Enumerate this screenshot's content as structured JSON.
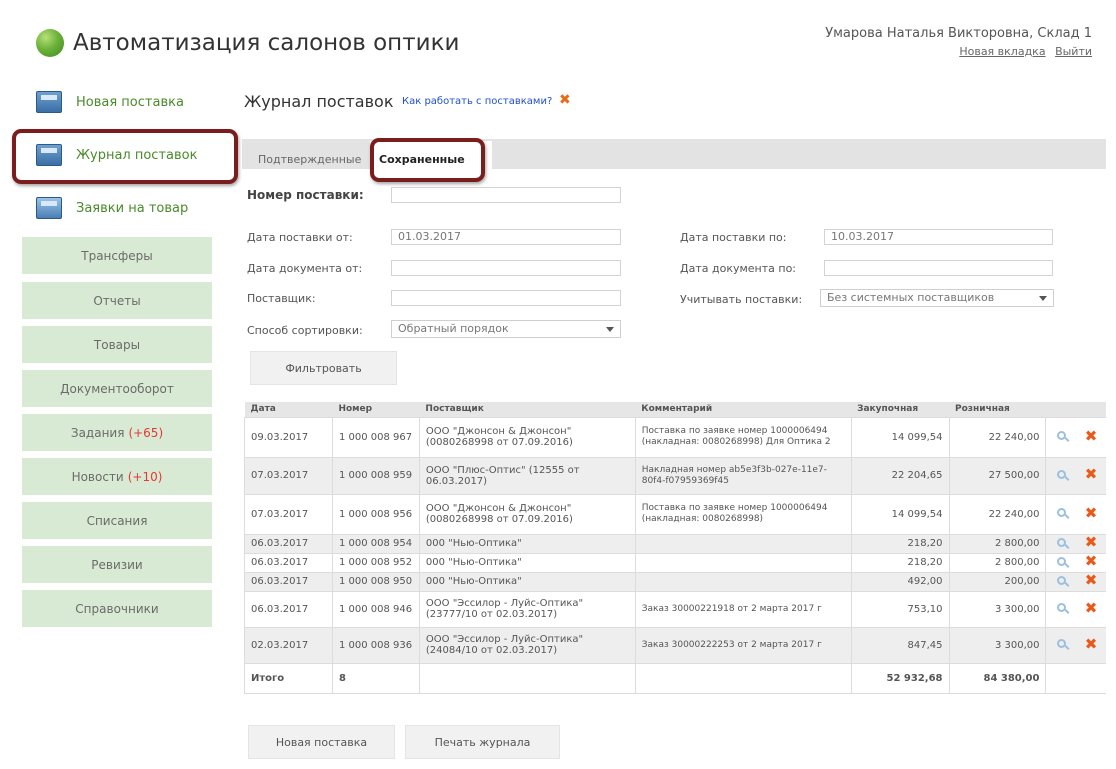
{
  "header": {
    "app_title": "Автоматизация салонов оптики",
    "user_name": "Умарова Наталья Викторовна, Склад 1",
    "new_tab_link": "Новая вкладка",
    "logout_link": "Выйти"
  },
  "sidebar": {
    "icon_items": [
      {
        "label": "Новая поставка",
        "icon": "delivery-box-icon"
      },
      {
        "label": "Журнал поставок",
        "icon": "journal-box-icon"
      },
      {
        "label": "Заявки на товар",
        "icon": "requests-icon"
      }
    ],
    "menu": [
      {
        "label": "Трансферы"
      },
      {
        "label": "Отчеты"
      },
      {
        "label": "Товары"
      },
      {
        "label": "Документооборот"
      },
      {
        "label": "Задания",
        "badge": "(+65)"
      },
      {
        "label": "Новости",
        "badge": "(+10)"
      },
      {
        "label": "Списания"
      },
      {
        "label": "Ревизии"
      },
      {
        "label": "Справочники"
      }
    ]
  },
  "main": {
    "title": "Журнал поставок",
    "help_link": "Как работать с поставками?",
    "tabs": [
      "Подтвержденные",
      "Сохраненные"
    ],
    "form": {
      "number_label": "Номер поставки:",
      "number_value": "",
      "date_from_label": "Дата поставки от:",
      "date_from_value": "01.03.2017",
      "date_to_label": "Дата поставки по:",
      "date_to_value": "10.03.2017",
      "doc_from_label": "Дата документа от:",
      "doc_from_value": "",
      "doc_to_label": "Дата документа по:",
      "doc_to_value": "",
      "supplier_label": "Поставщик:",
      "supplier_value": "",
      "count_label": "Учитывать поставки:",
      "count_value": "Без системных поставщиков",
      "sort_label": "Способ сортировки:",
      "sort_value": "Обратный порядок",
      "filter_button": "Фильтровать"
    },
    "table": {
      "headers": [
        "Дата",
        "Номер",
        "Поставщик",
        "Комментарий",
        "Закупочная",
        "Розничная"
      ],
      "rows": [
        {
          "date": "09.03.2017",
          "number": "1 000 008 967",
          "supplier": "ООО \"Джонсон & Джонсон\" (0080268998 от 07.09.2016)",
          "comment": "Поставка по заявке номер 1000006494 (накладная: 0080268998) Для Оптика 2",
          "purchase": "14 099,54",
          "retail": "22 240,00",
          "gray": false
        },
        {
          "date": "07.03.2017",
          "number": "1 000 008 959",
          "supplier": "ООО \"Плюс-Оптис\" (12555 от 06.03.2017)",
          "comment": "Накладная номер ab5e3f3b-027e-11e7-80f4-f07959369f45",
          "purchase": "22 204,65",
          "retail": "27 500,00",
          "gray": true
        },
        {
          "date": "07.03.2017",
          "number": "1 000 008 956",
          "supplier": "ООО \"Джонсон & Джонсон\" (0080268998 от 07.09.2016)",
          "comment": "Поставка по заявке номер 1000006494 (накладная: 0080268998)",
          "purchase": "14 099,54",
          "retail": "22 240,00",
          "gray": false
        },
        {
          "date": "06.03.2017",
          "number": "1 000 008 954",
          "supplier": "000 \"Нью-Оптика\"",
          "comment": "",
          "purchase": "218,20",
          "retail": "2 800,00",
          "gray": true
        },
        {
          "date": "06.03.2017",
          "number": "1 000 008 952",
          "supplier": "000 \"Нью-Оптика\"",
          "comment": "",
          "purchase": "218,20",
          "retail": "2 800,00",
          "gray": false
        },
        {
          "date": "06.03.2017",
          "number": "1 000 008 950",
          "supplier": "000 \"Нью-Оптика\"",
          "comment": "",
          "purchase": "492,00",
          "retail": "200,00",
          "gray": true
        },
        {
          "date": "06.03.2017",
          "number": "1 000 008 946",
          "supplier": "ООО \"Эссилор - Луйс-Оптика\" (23777/10 от 02.03.2017)",
          "comment": "Заказ 30000221918 от 2 марта 2017 г",
          "purchase": "753,10",
          "retail": "3 300,00",
          "gray": false
        },
        {
          "date": "02.03.2017",
          "number": "1 000 008 936",
          "supplier": "ООО \"Эссилор - Луйс-Оптика\" (24084/10 от 02.03.2017)",
          "comment": "Заказ 30000222253 от 2 марта 2017 г",
          "purchase": "847,45",
          "retail": "3 300,00",
          "gray": true
        }
      ],
      "total": {
        "label": "Итого",
        "count": "8",
        "purchase": "52 932,68",
        "retail": "84 380,00"
      }
    },
    "bottom_buttons": [
      "Новая поставка",
      "Печать журнала"
    ]
  },
  "colors": {
    "accent_green": "#4a8a2a",
    "menu_bg": "#d8ead3",
    "highlight_frame": "#7a1d1d",
    "delete_icon": "#e85a1a",
    "badge_red": "#e53935"
  }
}
